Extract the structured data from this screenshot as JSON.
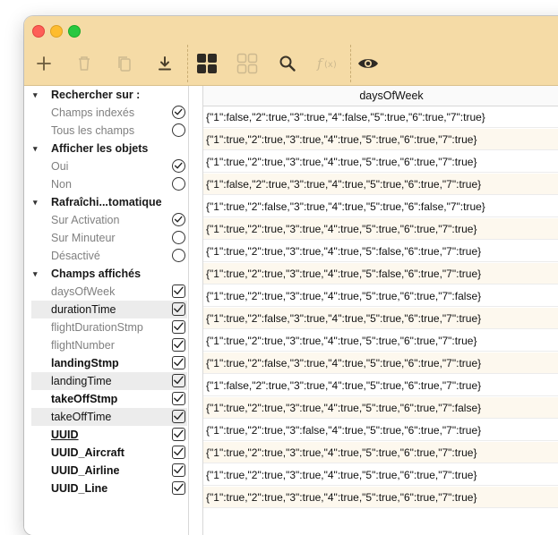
{
  "toolbar": {
    "icons": [
      "plus-icon",
      "trash-icon",
      "duplicate-icon",
      "download-icon",
      "grid-view-icon",
      "list-view-icon",
      "search-icon",
      "formula-icon",
      "eye-icon"
    ]
  },
  "sidebar": {
    "sections": [
      {
        "label": "Rechercher sur :",
        "items": [
          {
            "label": "Champs indexés",
            "control": "radio",
            "checked": true
          },
          {
            "label": "Tous les champs",
            "control": "radio",
            "checked": false
          }
        ]
      },
      {
        "label": "Afficher les objets",
        "items": [
          {
            "label": "Oui",
            "control": "radio",
            "checked": true
          },
          {
            "label": "Non",
            "control": "radio",
            "checked": false
          }
        ]
      },
      {
        "label": "Rafraîchi...tomatique",
        "items": [
          {
            "label": "Sur Activation",
            "control": "radio",
            "checked": true
          },
          {
            "label": "Sur Minuteur",
            "control": "radio",
            "checked": false
          },
          {
            "label": "Désactivé",
            "control": "radio",
            "checked": false
          }
        ]
      },
      {
        "label": "Champs affichés",
        "items": [
          {
            "label": "daysOfWeek",
            "control": "checkbox",
            "checked": true
          },
          {
            "label": "durationTime",
            "control": "checkbox",
            "checked": true
          },
          {
            "label": "flightDurationStmp",
            "control": "checkbox",
            "checked": true
          },
          {
            "label": "flightNumber",
            "control": "checkbox",
            "checked": true
          },
          {
            "label": "landingStmp",
            "control": "checkbox",
            "checked": true
          },
          {
            "label": "landingTime",
            "control": "checkbox",
            "checked": true
          },
          {
            "label": "takeOffStmp",
            "control": "checkbox",
            "checked": true
          },
          {
            "label": "takeOffTime",
            "control": "checkbox",
            "checked": true
          },
          {
            "label": "UUID",
            "control": "checkbox",
            "checked": true
          },
          {
            "label": "UUID_Aircraft",
            "control": "checkbox",
            "checked": true
          },
          {
            "label": "UUID_Airline",
            "control": "checkbox",
            "checked": true
          },
          {
            "label": "UUID_Line",
            "control": "checkbox",
            "checked": true
          }
        ]
      }
    ]
  },
  "table": {
    "column": "daysOfWeek",
    "rows": [
      "{\"1\":false,\"2\":true,\"3\":true,\"4\":false,\"5\":true,\"6\":true,\"7\":true}",
      "{\"1\":true,\"2\":true,\"3\":true,\"4\":true,\"5\":true,\"6\":true,\"7\":true}",
      "{\"1\":true,\"2\":true,\"3\":true,\"4\":true,\"5\":true,\"6\":true,\"7\":true}",
      "{\"1\":false,\"2\":true,\"3\":true,\"4\":true,\"5\":true,\"6\":true,\"7\":true}",
      "{\"1\":true,\"2\":false,\"3\":true,\"4\":true,\"5\":true,\"6\":false,\"7\":true}",
      "{\"1\":true,\"2\":true,\"3\":true,\"4\":true,\"5\":true,\"6\":true,\"7\":true}",
      "{\"1\":true,\"2\":true,\"3\":true,\"4\":true,\"5\":false,\"6\":true,\"7\":true}",
      "{\"1\":true,\"2\":true,\"3\":true,\"4\":true,\"5\":false,\"6\":true,\"7\":true}",
      "{\"1\":true,\"2\":true,\"3\":true,\"4\":true,\"5\":true,\"6\":true,\"7\":false}",
      "{\"1\":true,\"2\":false,\"3\":true,\"4\":true,\"5\":true,\"6\":true,\"7\":true}",
      "{\"1\":true,\"2\":true,\"3\":true,\"4\":true,\"5\":true,\"6\":true,\"7\":true}",
      "{\"1\":true,\"2\":false,\"3\":true,\"4\":true,\"5\":true,\"6\":true,\"7\":true}",
      "{\"1\":false,\"2\":true,\"3\":true,\"4\":true,\"5\":true,\"6\":true,\"7\":true}",
      "{\"1\":true,\"2\":true,\"3\":true,\"4\":true,\"5\":true,\"6\":true,\"7\":false}",
      "{\"1\":true,\"2\":true,\"3\":false,\"4\":true,\"5\":true,\"6\":true,\"7\":true}",
      "{\"1\":true,\"2\":true,\"3\":true,\"4\":true,\"5\":true,\"6\":true,\"7\":true}",
      "{\"1\":true,\"2\":true,\"3\":true,\"4\":true,\"5\":true,\"6\":true,\"7\":true}",
      "{\"1\":true,\"2\":true,\"3\":true,\"4\":true,\"5\":true,\"6\":true,\"7\":true}"
    ]
  }
}
